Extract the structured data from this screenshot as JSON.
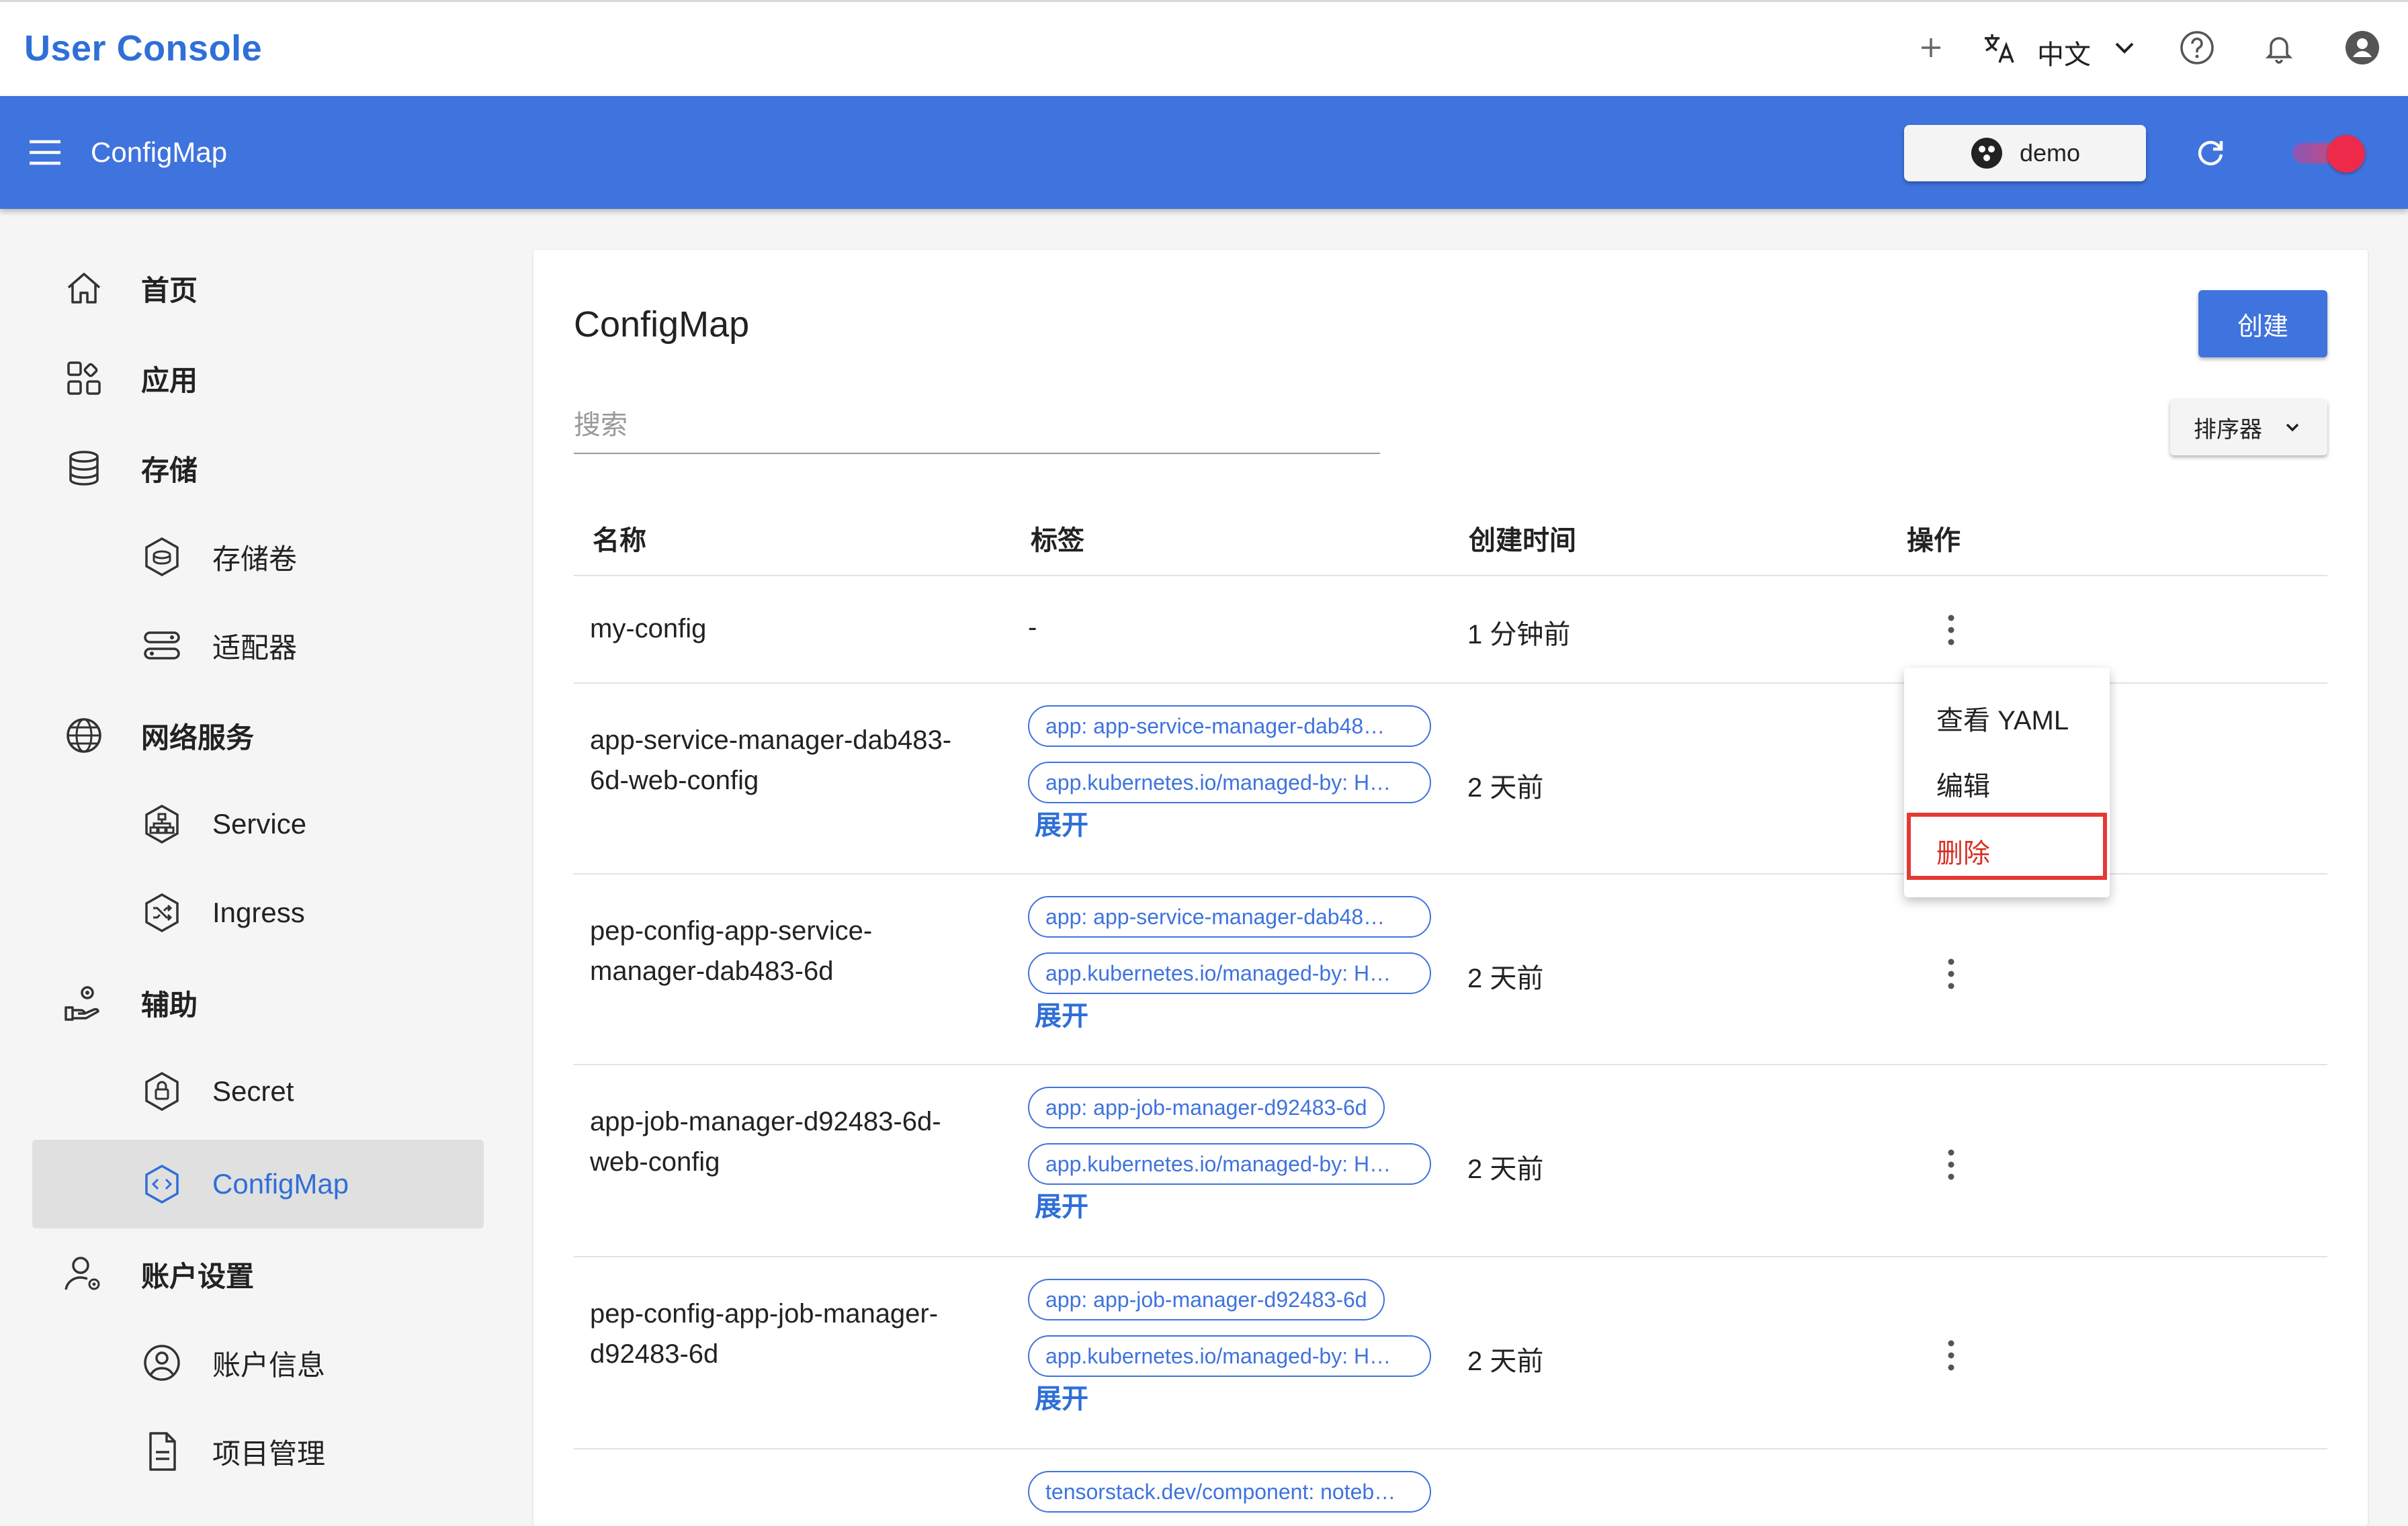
{
  "topbar": {
    "app_title": "User Console",
    "language_label": "中文",
    "icons": [
      "add-icon",
      "translate-icon",
      "chevron-down-icon",
      "help-icon",
      "bell-icon",
      "account-icon"
    ]
  },
  "header": {
    "page_title": "ConfigMap",
    "namespace": "demo",
    "colors": {
      "bar": "#3f73de",
      "accent": "#2f6fd8",
      "toggle": "#ee2a4a"
    }
  },
  "sidebar": {
    "items": [
      {
        "label": "首页",
        "icon": "home-icon"
      },
      {
        "label": "应用",
        "icon": "apps-icon"
      },
      {
        "label": "存储",
        "icon": "database-icon"
      },
      {
        "label": "存储卷",
        "icon": "volume-icon"
      },
      {
        "label": "适配器",
        "icon": "adapter-icon"
      },
      {
        "label": "网络服务",
        "icon": "globe-icon"
      },
      {
        "label": "Service",
        "icon": "service-icon"
      },
      {
        "label": "Ingress",
        "icon": "ingress-icon"
      },
      {
        "label": "辅助",
        "icon": "auxiliary-icon"
      },
      {
        "label": "Secret",
        "icon": "lock-icon"
      },
      {
        "label": "ConfigMap",
        "icon": "code-icon"
      },
      {
        "label": "账户设置",
        "icon": "user-settings-icon"
      },
      {
        "label": "账户信息",
        "icon": "account-circle-icon"
      },
      {
        "label": "项目管理",
        "icon": "document-icon"
      }
    ]
  },
  "main": {
    "title": "ConfigMap",
    "create_label": "创建",
    "search_placeholder": "搜索",
    "sort_label": "排序器",
    "columns": [
      "名称",
      "标签",
      "创建时间",
      "操作"
    ],
    "expand_label": "展开",
    "rows": [
      {
        "name_lines": [
          "my-config"
        ],
        "labels": [],
        "no_label": "-",
        "created": "1 分钟前"
      },
      {
        "name_lines": [
          "app-service-manager-dab483-",
          "6d-web-config"
        ],
        "labels": [
          "app: app-service-manager-dab48…",
          "app.kubernetes.io/managed-by: H…"
        ],
        "created": "2 天前"
      },
      {
        "name_lines": [
          "pep-config-app-service-",
          "manager-dab483-6d"
        ],
        "labels": [
          "app: app-service-manager-dab48…",
          "app.kubernetes.io/managed-by: H…"
        ],
        "created": "2 天前"
      },
      {
        "name_lines": [
          "app-job-manager-d92483-6d-",
          "web-config"
        ],
        "labels": [
          "app: app-job-manager-d92483-6d",
          "app.kubernetes.io/managed-by: H…"
        ],
        "created": "2 天前"
      },
      {
        "name_lines": [
          "pep-config-app-job-manager-",
          "d92483-6d"
        ],
        "labels": [
          "app: app-job-manager-d92483-6d",
          "app.kubernetes.io/managed-by: H…"
        ],
        "created": "2 天前"
      },
      {
        "name_lines": [
          ""
        ],
        "labels": [
          "tensorstack.dev/component: noteb…"
        ],
        "created": ""
      }
    ]
  },
  "action_menu": {
    "items": [
      "查看 YAML",
      "编辑",
      "删除"
    ],
    "highlighted": "删除"
  }
}
